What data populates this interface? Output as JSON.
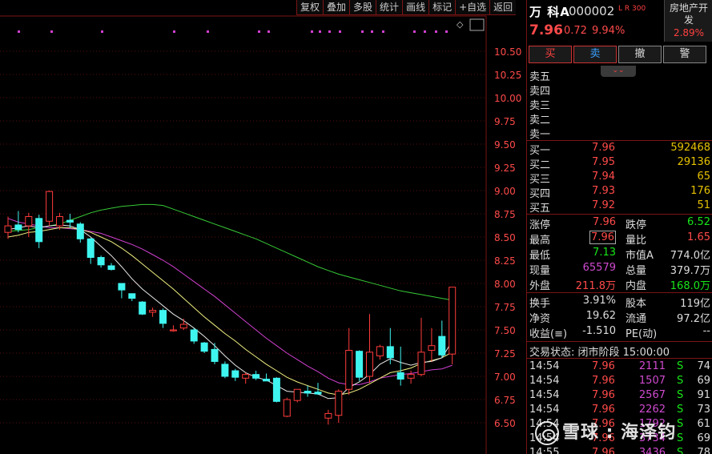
{
  "toolbar": [
    "复权",
    "叠加",
    "多股",
    "统计",
    "画线",
    "标记",
    "+自选",
    "返回"
  ],
  "stock": {
    "name": "万 科A",
    "code": "000002",
    "tags": "L R 300",
    "price": "7.96",
    "change": "0.72",
    "change_pct": "9.94%",
    "sector": "房地产开发",
    "sector_pct": "2.89%"
  },
  "trade_buttons": [
    "买",
    "卖",
    "撤",
    "警"
  ],
  "collapse_icon": "chevron-double-down",
  "ask_rows": [
    {
      "label": "卖五",
      "price": "",
      "vol": ""
    },
    {
      "label": "卖四",
      "price": "",
      "vol": ""
    },
    {
      "label": "卖三",
      "price": "",
      "vol": ""
    },
    {
      "label": "卖二",
      "price": "",
      "vol": ""
    },
    {
      "label": "卖一",
      "price": "",
      "vol": ""
    }
  ],
  "bid_rows": [
    {
      "label": "买一",
      "price": "7.96",
      "vol": "592468"
    },
    {
      "label": "买二",
      "price": "7.95",
      "vol": "29136"
    },
    {
      "label": "买三",
      "price": "7.94",
      "vol": "65"
    },
    {
      "label": "买四",
      "price": "7.93",
      "vol": "176"
    },
    {
      "label": "买五",
      "price": "7.92",
      "vol": "51"
    }
  ],
  "quote": {
    "limit_up_label": "涨停",
    "limit_up": "7.96",
    "limit_down_label": "跌停",
    "limit_down": "6.52",
    "high_label": "最高",
    "high": "7.96",
    "vol_ratio_label": "量比",
    "vol_ratio": "1.65",
    "low_label": "最低",
    "low": "7.13",
    "mktcap_a_label": "市值A",
    "mktcap_a": "774.0亿",
    "cur_vol_label": "现量",
    "cur_vol": "65579",
    "total_vol_label": "总量",
    "total_vol": "379.7万",
    "outer_label": "外盘",
    "outer": "211.8万",
    "inner_label": "内盘",
    "inner": "168.0万",
    "turnover_label": "换手",
    "turnover": "3.91%",
    "share_cap_label": "股本",
    "share_cap": "119亿",
    "nav_label": "净资",
    "nav": "19.62",
    "float_label": "流通",
    "float_cap": "97.2亿",
    "eps_label": "收益(≡)",
    "eps": "-1.510",
    "pe_label": "PE(动)",
    "pe": "--"
  },
  "tick_header": "交易状态: 闭市阶段 15:00:00",
  "ticks": [
    {
      "time": "14:54",
      "price": "7.96",
      "vol": "2111",
      "side": "S",
      "count": "74"
    },
    {
      "time": "14:54",
      "price": "7.96",
      "vol": "1507",
      "side": "S",
      "count": "69"
    },
    {
      "time": "14:54",
      "price": "7.96",
      "vol": "2567",
      "side": "S",
      "count": "91"
    },
    {
      "time": "14:54",
      "price": "7.96",
      "vol": "2262",
      "side": "S",
      "count": "73"
    },
    {
      "time": "14:54",
      "price": "7.96",
      "vol": "1792",
      "side": "S",
      "count": "61"
    },
    {
      "time": "14:54",
      "price": "7.96",
      "vol": "3734",
      "side": "S",
      "count": "69"
    },
    {
      "time": "14:55",
      "price": "7.96",
      "vol": "3436",
      "side": "S",
      "count": "78"
    }
  ],
  "watermark": "雪球 : 海泽钧",
  "chart_data": {
    "type": "candlestick",
    "ylim": [
      6.4,
      10.6
    ],
    "y_ticks": [
      "10.50",
      "10.25",
      "10.00",
      "9.75",
      "9.50",
      "9.25",
      "9.00",
      "8.75",
      "8.50",
      "8.25",
      "8.00",
      "7.75",
      "7.50",
      "7.25",
      "7.00",
      "6.75",
      "6.50"
    ],
    "colors": {
      "up": "#ff3b3b",
      "down": "#3ff5f0",
      "ma_white": "#e8e8e8",
      "ma_yellow": "#f0f080",
      "ma_purple": "#d040d0",
      "ma_green": "#36c936",
      "grid": "#5a0e0e"
    },
    "candles": [
      {
        "o": 8.55,
        "h": 8.72,
        "l": 8.48,
        "c": 8.62
      },
      {
        "o": 8.63,
        "h": 8.78,
        "l": 8.55,
        "c": 8.58
      },
      {
        "o": 8.62,
        "h": 8.76,
        "l": 8.5,
        "c": 8.72
      },
      {
        "o": 8.7,
        "h": 8.74,
        "l": 8.38,
        "c": 8.45
      },
      {
        "o": 8.67,
        "h": 9.0,
        "l": 8.62,
        "c": 8.99
      },
      {
        "o": 8.62,
        "h": 8.76,
        "l": 8.58,
        "c": 8.72
      },
      {
        "o": 8.68,
        "h": 8.75,
        "l": 8.6,
        "c": 8.66
      },
      {
        "o": 8.64,
        "h": 8.66,
        "l": 8.44,
        "c": 8.48
      },
      {
        "o": 8.48,
        "h": 8.49,
        "l": 8.21,
        "c": 8.28
      },
      {
        "o": 8.28,
        "h": 8.3,
        "l": 8.17,
        "c": 8.2
      },
      {
        "o": 8.19,
        "h": 8.22,
        "l": 8.14,
        "c": 8.15
      },
      {
        "o": 8.0,
        "h": 8.0,
        "l": 7.84,
        "c": 7.93
      },
      {
        "o": 7.89,
        "h": 7.89,
        "l": 7.81,
        "c": 7.84
      },
      {
        "o": 7.8,
        "h": 7.81,
        "l": 7.66,
        "c": 7.67
      },
      {
        "o": 7.69,
        "h": 7.74,
        "l": 7.64,
        "c": 7.71
      },
      {
        "o": 7.71,
        "h": 7.73,
        "l": 7.52,
        "c": 7.57
      },
      {
        "o": 7.49,
        "h": 7.55,
        "l": 7.48,
        "c": 7.5
      },
      {
        "o": 7.52,
        "h": 7.62,
        "l": 7.5,
        "c": 7.56
      },
      {
        "o": 7.5,
        "h": 7.52,
        "l": 7.35,
        "c": 7.38
      },
      {
        "o": 7.36,
        "h": 7.37,
        "l": 7.25,
        "c": 7.27
      },
      {
        "o": 7.29,
        "h": 7.36,
        "l": 7.13,
        "c": 7.16
      },
      {
        "o": 7.13,
        "h": 7.16,
        "l": 6.98,
        "c": 7.0
      },
      {
        "o": 7.06,
        "h": 7.08,
        "l": 6.95,
        "c": 6.99
      },
      {
        "o": 6.98,
        "h": 7.04,
        "l": 6.92,
        "c": 7.02
      },
      {
        "o": 7.02,
        "h": 7.06,
        "l": 6.96,
        "c": 6.98
      },
      {
        "o": 6.97,
        "h": 7.03,
        "l": 6.95,
        "c": 6.95
      },
      {
        "o": 6.98,
        "h": 6.99,
        "l": 6.72,
        "c": 6.73
      },
      {
        "o": 6.57,
        "h": 6.77,
        "l": 6.56,
        "c": 6.75
      },
      {
        "o": 6.74,
        "h": 6.86,
        "l": 6.72,
        "c": 6.86
      },
      {
        "o": 6.84,
        "h": 6.9,
        "l": 6.78,
        "c": 6.82
      },
      {
        "o": 6.83,
        "h": 6.93,
        "l": 6.8,
        "c": 6.81
      },
      {
        "o": 6.55,
        "h": 6.64,
        "l": 6.48,
        "c": 6.6
      },
      {
        "o": 6.58,
        "h": 6.86,
        "l": 6.5,
        "c": 6.84
      },
      {
        "o": 6.86,
        "h": 7.52,
        "l": 6.8,
        "c": 7.28
      },
      {
        "o": 7.27,
        "h": 7.28,
        "l": 6.95,
        "c": 6.99
      },
      {
        "o": 7.0,
        "h": 7.67,
        "l": 6.93,
        "c": 7.26
      },
      {
        "o": 7.22,
        "h": 7.34,
        "l": 7.18,
        "c": 7.32
      },
      {
        "o": 7.32,
        "h": 7.52,
        "l": 7.13,
        "c": 7.2
      },
      {
        "o": 7.04,
        "h": 7.32,
        "l": 6.9,
        "c": 6.97
      },
      {
        "o": 6.98,
        "h": 7.06,
        "l": 6.92,
        "c": 7.02
      },
      {
        "o": 7.02,
        "h": 7.63,
        "l": 7.0,
        "c": 7.26
      },
      {
        "o": 7.28,
        "h": 7.52,
        "l": 7.16,
        "c": 7.33
      },
      {
        "o": 7.43,
        "h": 7.6,
        "l": 7.2,
        "c": 7.23
      },
      {
        "o": 7.24,
        "h": 7.96,
        "l": 7.13,
        "c": 7.96
      }
    ],
    "ma_white": [
      8.58,
      8.6,
      8.62,
      8.6,
      8.62,
      8.63,
      8.62,
      8.58,
      8.5,
      8.4,
      8.3,
      8.18,
      8.05,
      7.94,
      7.85,
      7.76,
      7.67,
      7.6,
      7.52,
      7.43,
      7.33,
      7.22,
      7.12,
      7.04,
      6.99,
      6.96,
      6.9,
      6.84,
      6.83,
      6.82,
      6.81,
      6.76,
      6.77,
      6.88,
      6.94,
      7.02,
      7.13,
      7.19,
      7.15,
      7.12,
      7.15,
      7.16,
      7.2,
      7.38
    ],
    "ma_yellow": [
      8.5,
      8.52,
      8.55,
      8.56,
      8.58,
      8.6,
      8.6,
      8.58,
      8.55,
      8.5,
      8.45,
      8.38,
      8.3,
      8.21,
      8.12,
      8.03,
      7.94,
      7.84,
      7.74,
      7.64,
      7.55,
      7.46,
      7.38,
      7.29,
      7.21,
      7.13,
      7.06,
      6.99,
      6.94,
      6.9,
      6.86,
      6.82,
      6.8,
      6.82,
      6.86,
      6.92,
      6.98,
      7.04,
      7.06,
      7.09,
      7.14,
      7.17,
      7.2,
      7.26
    ],
    "ma_purple": [
      8.7,
      8.66,
      8.64,
      8.62,
      8.6,
      8.6,
      8.59,
      8.58,
      8.56,
      8.54,
      8.5,
      8.46,
      8.42,
      8.37,
      8.31,
      8.25,
      8.18,
      8.1,
      8.02,
      7.94,
      7.86,
      7.77,
      7.68,
      7.59,
      7.5,
      7.41,
      7.33,
      7.25,
      7.18,
      7.11,
      7.05,
      6.98,
      6.93,
      6.91,
      6.91,
      6.94,
      6.98,
      7.0,
      7.02,
      7.03,
      7.05,
      7.07,
      7.08,
      7.12
    ],
    "ma_green": [
      8.56,
      8.57,
      8.58,
      8.6,
      8.62,
      8.64,
      8.68,
      8.72,
      8.76,
      8.79,
      8.81,
      8.83,
      8.84,
      8.85,
      8.85,
      8.84,
      8.8,
      8.76,
      8.72,
      8.68,
      8.64,
      8.6,
      8.56,
      8.52,
      8.48,
      8.43,
      8.38,
      8.33,
      8.28,
      8.23,
      8.18,
      8.14,
      8.1,
      8.07,
      8.04,
      8.01,
      7.98,
      7.95,
      7.92,
      7.9,
      7.88,
      7.86,
      7.84,
      7.82
    ],
    "marker_dots_x": [
      22,
      63,
      126,
      216,
      258,
      322,
      334,
      388,
      398,
      410,
      423,
      451,
      463,
      477,
      516,
      529,
      543,
      556
    ]
  }
}
